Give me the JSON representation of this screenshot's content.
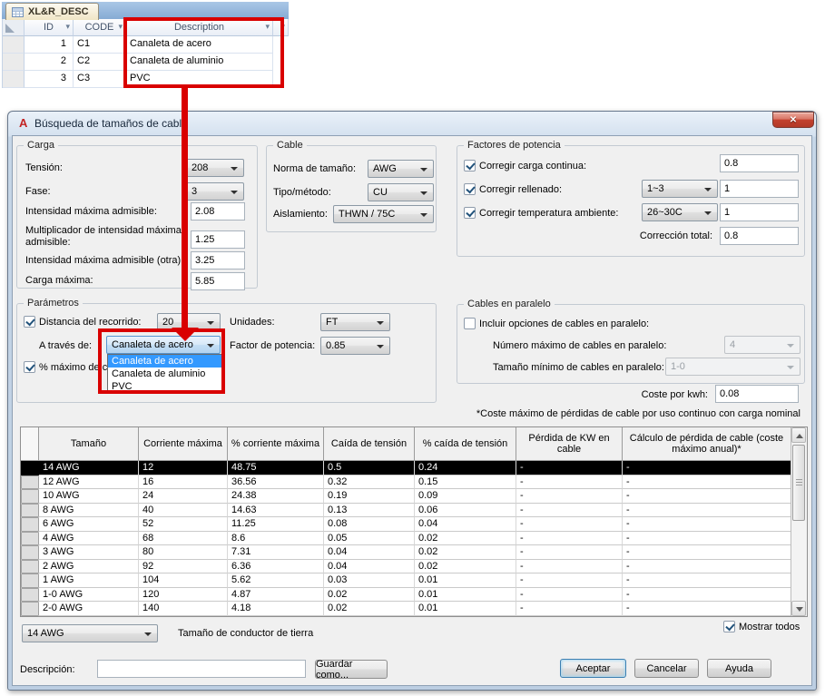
{
  "colors": {
    "annotation_red": "#d90000",
    "selection_blue": "#3399ff",
    "selected_row_bg": "#000000",
    "close_button_red": "#c3422e"
  },
  "access_table": {
    "tab_label": "XL&R_DESC",
    "col_id": "ID",
    "col_code": "CODE",
    "col_desc": "Description",
    "sort_arrow": "▾",
    "rows": [
      {
        "id": "1",
        "code": "C1",
        "desc": "Canaleta de acero"
      },
      {
        "id": "2",
        "code": "C2",
        "desc": "Canaleta de aluminio"
      },
      {
        "id": "3",
        "code": "C3",
        "desc": "PVC"
      }
    ]
  },
  "dialog": {
    "app_icon_glyph": "A",
    "title": "Búsqueda de tamaños de cable",
    "close_glyph": "✕",
    "carga": {
      "legend": "Carga",
      "tension_label": "Tensión:",
      "tension_value": "208",
      "fase_label": "Fase:",
      "fase_value": "3",
      "imax_label": "Intensidad máxima admisible:",
      "imax_value": "2.08",
      "mult_label": "Multiplicador de intensidad máxima admisible:",
      "mult_value": "1.25",
      "imax_otra_label": "Intensidad máxima admisible (otra):",
      "imax_otra_value": "3.25",
      "carga_max_label": "Carga máxima:",
      "carga_max_value": "5.85"
    },
    "cable": {
      "legend": "Cable",
      "norma_label": "Norma de tamaño:",
      "norma_value": "AWG",
      "tipo_label": "Tipo/método:",
      "tipo_value": "CU",
      "aisl_label": "Aislamiento:",
      "aisl_value": "THWN / 75C"
    },
    "factores": {
      "legend": "Factores de potencia",
      "continua_label": "Corregir carga continua:",
      "continua_value": "0.8",
      "rellenado_label": "Corregir rellenado:",
      "rellenado_combo": "1~3",
      "rellenado_value": "1",
      "temp_label": "Corregir temperatura ambiente:",
      "temp_combo": "26~30C",
      "temp_value": "1",
      "total_label": "Corrección total:",
      "total_value": "0.8"
    },
    "parametros": {
      "legend": "Parámetros",
      "distancia_label": "Distancia del recorrido:",
      "distancia_value": "20",
      "unidades_label": "Unidades:",
      "unidades_value": "FT",
      "atraves_label": "A través de:",
      "atraves_value": "Canaleta de acero",
      "factor_label": "Factor de potencia:",
      "factor_value": "0.85",
      "maximo_label": "% máximo de ca",
      "dropdown_items": [
        "Canaleta de acero",
        "Canaleta de aluminio",
        "PVC"
      ]
    },
    "paralelo": {
      "legend": "Cables en paralelo",
      "incluir_label": "Incluir opciones de cables en paralelo:",
      "num_label": "Número máximo de cables en paralelo:",
      "num_value": "4",
      "tam_label": "Tamaño mínimo de cables en paralelo:",
      "tam_value": "1-0"
    },
    "coste": {
      "label": "Coste por kwh:",
      "value": "0.08",
      "note": "*Coste máximo de pérdidas de cable por uso continuo con carga nominal"
    },
    "results": {
      "headers": [
        "Tamaño",
        "Corriente máxima",
        "% corriente máxima",
        "Caída de tensión",
        "% caída de tensión",
        "Pérdida de KW en cable",
        "Cálculo de pérdida de cable (coste máximo anual)*"
      ],
      "rows": [
        [
          "14 AWG",
          "12",
          "48.75",
          "0.5",
          "0.24",
          "-",
          "-"
        ],
        [
          "12 AWG",
          "16",
          "36.56",
          "0.32",
          "0.15",
          "-",
          "-"
        ],
        [
          "10 AWG",
          "24",
          "24.38",
          "0.19",
          "0.09",
          "-",
          "-"
        ],
        [
          "8 AWG",
          "40",
          "14.63",
          "0.13",
          "0.06",
          "-",
          "-"
        ],
        [
          "6 AWG",
          "52",
          "11.25",
          "0.08",
          "0.04",
          "-",
          "-"
        ],
        [
          "4 AWG",
          "68",
          "8.6",
          "0.05",
          "0.02",
          "-",
          "-"
        ],
        [
          "3 AWG",
          "80",
          "7.31",
          "0.04",
          "0.02",
          "-",
          "-"
        ],
        [
          "2 AWG",
          "92",
          "6.36",
          "0.04",
          "0.02",
          "-",
          "-"
        ],
        [
          "1 AWG",
          "104",
          "5.62",
          "0.03",
          "0.01",
          "-",
          "-"
        ],
        [
          "1-0 AWG",
          "120",
          "4.87",
          "0.02",
          "0.01",
          "-",
          "-"
        ],
        [
          "2-0 AWG",
          "140",
          "4.18",
          "0.02",
          "0.01",
          "-",
          "-"
        ]
      ]
    },
    "footer": {
      "ground_value": "14 AWG",
      "ground_label": "Tamaño de conductor de tierra",
      "mostrar_label": "Mostrar todos",
      "desc_label": "Descripción:",
      "desc_value": "",
      "guardar_label": "Guardar como...",
      "aceptar_label": "Aceptar",
      "cancelar_label": "Cancelar",
      "ayuda_label": "Ayuda"
    }
  }
}
